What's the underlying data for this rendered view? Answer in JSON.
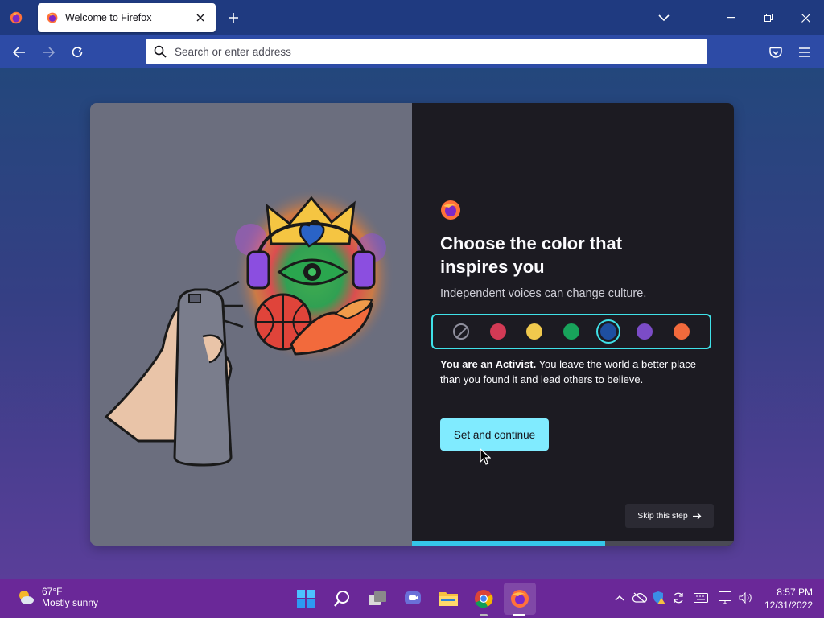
{
  "browser": {
    "tab": {
      "title": "Welcome to Firefox"
    },
    "urlbar": {
      "placeholder": "Search or enter address"
    }
  },
  "onboarding": {
    "headline": "Choose the color that inspires you",
    "subheadline": "Independent voices can change culture.",
    "swatches": [
      {
        "name": "none",
        "color": "transparent"
      },
      {
        "name": "red",
        "color": "#d23a55"
      },
      {
        "name": "yellow",
        "color": "#f0c94d"
      },
      {
        "name": "green",
        "color": "#18a35b"
      },
      {
        "name": "blue",
        "color": "#1e4fa0",
        "selected": true
      },
      {
        "name": "purple",
        "color": "#7b4cc7"
      },
      {
        "name": "orange",
        "color": "#f26a3c"
      }
    ],
    "description_bold": "You are an Activist.",
    "description_rest": " You leave the world a better place than you found it and lead others to believe.",
    "primary_button": "Set and continue",
    "skip_button": "Skip this step",
    "progress": 0.6
  },
  "taskbar": {
    "weather": {
      "temp": "67°F",
      "condition": "Mostly sunny"
    },
    "clock": {
      "time": "8:57 PM",
      "date": "12/31/2022"
    }
  }
}
